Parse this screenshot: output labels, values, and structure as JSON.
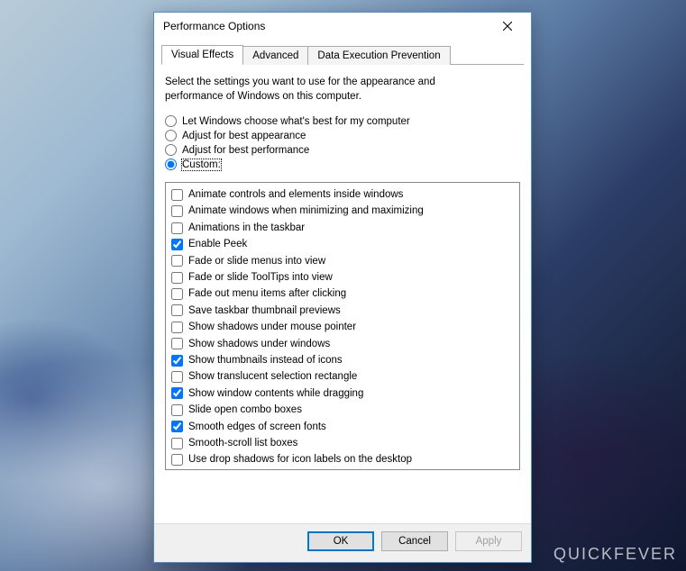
{
  "watermark": "QUICKFEVER",
  "dialog": {
    "title": "Performance Options"
  },
  "tabs": [
    {
      "id": "visual-effects",
      "label": "Visual Effects",
      "active": true
    },
    {
      "id": "advanced",
      "label": "Advanced",
      "active": false
    },
    {
      "id": "dep",
      "label": "Data Execution Prevention",
      "active": false
    }
  ],
  "intro": "Select the settings you want to use for the appearance and performance of Windows on this computer.",
  "radios": [
    {
      "id": "let-windows",
      "label": "Let Windows choose what's best for my computer",
      "selected": false
    },
    {
      "id": "best-appearance",
      "label": "Adjust for best appearance",
      "selected": false
    },
    {
      "id": "best-performance",
      "label": "Adjust for best performance",
      "selected": false
    },
    {
      "id": "custom",
      "label": "Custom:",
      "selected": true
    }
  ],
  "checklist": [
    {
      "id": "animate-controls",
      "label": "Animate controls and elements inside windows",
      "checked": false
    },
    {
      "id": "animate-minmax",
      "label": "Animate windows when minimizing and maximizing",
      "checked": false
    },
    {
      "id": "animations-taskbar",
      "label": "Animations in the taskbar",
      "checked": false
    },
    {
      "id": "enable-peek",
      "label": "Enable Peek",
      "checked": true
    },
    {
      "id": "fade-menus",
      "label": "Fade or slide menus into view",
      "checked": false
    },
    {
      "id": "fade-tooltips",
      "label": "Fade or slide ToolTips into view",
      "checked": false
    },
    {
      "id": "fade-menu-items",
      "label": "Fade out menu items after clicking",
      "checked": false
    },
    {
      "id": "save-taskbar-thumbs",
      "label": "Save taskbar thumbnail previews",
      "checked": false
    },
    {
      "id": "shadows-mouse",
      "label": "Show shadows under mouse pointer",
      "checked": false
    },
    {
      "id": "shadows-windows",
      "label": "Show shadows under windows",
      "checked": false
    },
    {
      "id": "thumbnails",
      "label": "Show thumbnails instead of icons",
      "checked": true
    },
    {
      "id": "translucent-select",
      "label": "Show translucent selection rectangle",
      "checked": false
    },
    {
      "id": "window-contents-drag",
      "label": "Show window contents while dragging",
      "checked": true
    },
    {
      "id": "slide-combo",
      "label": "Slide open combo boxes",
      "checked": false
    },
    {
      "id": "smooth-fonts",
      "label": "Smooth edges of screen fonts",
      "checked": true
    },
    {
      "id": "smooth-scroll",
      "label": "Smooth-scroll list boxes",
      "checked": false
    },
    {
      "id": "drop-shadows-desktop",
      "label": "Use drop shadows for icon labels on the desktop",
      "checked": false
    }
  ],
  "buttons": {
    "ok": "OK",
    "cancel": "Cancel",
    "apply": "Apply"
  }
}
